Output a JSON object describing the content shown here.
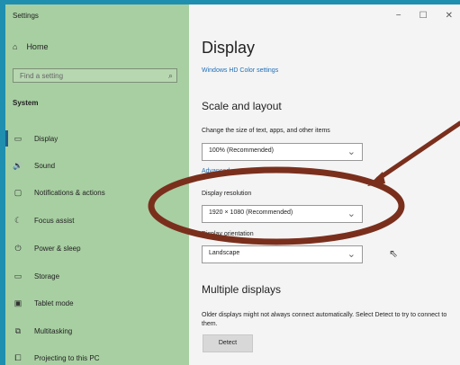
{
  "window": {
    "title": "Settings",
    "controls": [
      "−",
      "☐",
      "✕"
    ]
  },
  "sidebar": {
    "home_label": "Home",
    "search_placeholder": "Find a setting",
    "section": "System",
    "items": [
      {
        "label": "Display",
        "icon": "display-icon"
      },
      {
        "label": "Sound",
        "icon": "sound-icon"
      },
      {
        "label": "Notifications & actions",
        "icon": "notifications-icon"
      },
      {
        "label": "Focus assist",
        "icon": "focus-icon"
      },
      {
        "label": "Power & sleep",
        "icon": "power-icon"
      },
      {
        "label": "Storage",
        "icon": "storage-icon"
      },
      {
        "label": "Tablet mode",
        "icon": "tablet-icon"
      },
      {
        "label": "Multitasking",
        "icon": "multitasking-icon"
      },
      {
        "label": "Projecting to this PC",
        "icon": "project-icon"
      }
    ]
  },
  "main": {
    "title": "Display",
    "hd_link": "Windows HD Color settings",
    "scale_section": "Scale and layout",
    "scale_label": "Change the size of text, apps, and other items",
    "scale_value": "100% (Recommended)",
    "advanced_link": "Advanced",
    "resolution_label": "Display resolution",
    "resolution_value": "1920 × 1080 (Recommended)",
    "orientation_label": "Display orientation",
    "orientation_value": "Landscape",
    "multiple_section": "Multiple displays",
    "multiple_text": "Older displays might not always connect automatically. Select Detect to try to connect to them.",
    "detect_button": "Detect"
  },
  "colors": {
    "sidebar": "#a8cfa2",
    "accent": "#1f6fb8",
    "highlight": "#7a2f1d"
  }
}
